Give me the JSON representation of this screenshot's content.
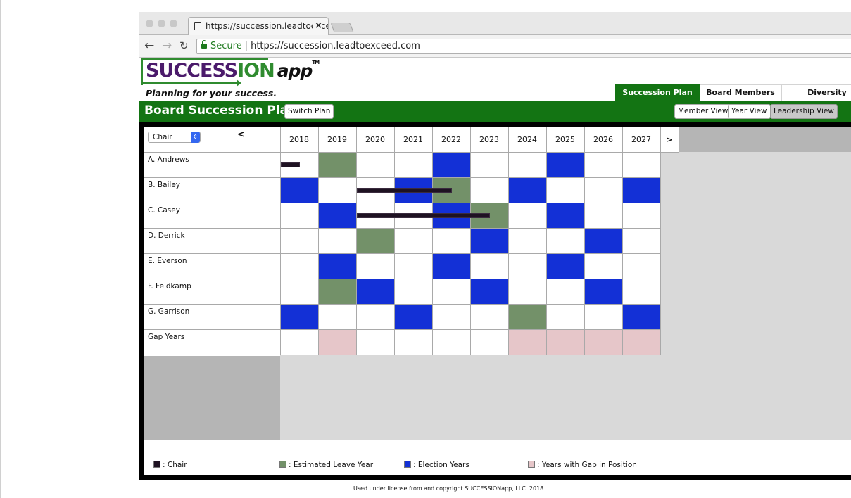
{
  "browser": {
    "tab_title": "https://succession.leadtoexceed.com",
    "close_glyph": "×",
    "secure_label": "Secure",
    "url": "https://succession.leadtoexceed.com"
  },
  "logo": {
    "part1": "SUCCESS",
    "part2": "ION",
    "part3": "app",
    "tm": "TM",
    "tagline": "Planning for your success."
  },
  "nav_tabs": [
    {
      "label": "Succession Plan",
      "active": true
    },
    {
      "label": "Board Members",
      "active": false
    },
    {
      "label": "Diversity",
      "active": false
    }
  ],
  "header": {
    "title": "Board Succession Plan",
    "switch_plan": "Switch Plan",
    "views": [
      {
        "label": "Member View",
        "selected": false
      },
      {
        "label": "Year View",
        "selected": false
      },
      {
        "label": "Leadership View",
        "selected": true
      }
    ]
  },
  "grid": {
    "position_select": "Chair",
    "prev_label": "<",
    "next_label": ">",
    "years": [
      "2018",
      "2019",
      "2020",
      "2021",
      "2022",
      "2023",
      "2024",
      "2025",
      "2026",
      "2027"
    ],
    "colors": {
      "chair": "#1e1222",
      "leave": "#739169",
      "election": "#1330d6",
      "gap": "#e6c6c9",
      "empty": "#ffffff"
    },
    "rows": [
      {
        "name": "A. Andrews",
        "cells": [
          "",
          "leave",
          "",
          "",
          "election",
          "",
          "",
          "election",
          "",
          ""
        ],
        "chair": {
          "start": 0,
          "end": 0.5
        }
      },
      {
        "name": "B. Bailey",
        "cells": [
          "election",
          "",
          "",
          "election",
          "leave",
          "",
          "election",
          "",
          "",
          "election"
        ],
        "chair": {
          "start": 2,
          "end": 4.5
        }
      },
      {
        "name": "C. Casey",
        "cells": [
          "",
          "election",
          "",
          "",
          "election",
          "leave",
          "",
          "election",
          "",
          ""
        ],
        "chair": {
          "start": 2,
          "end": 5.5
        }
      },
      {
        "name": "D. Derrick",
        "cells": [
          "",
          "",
          "leave",
          "",
          "",
          "election",
          "",
          "",
          "election",
          ""
        ]
      },
      {
        "name": "E. Everson",
        "cells": [
          "",
          "election",
          "",
          "",
          "election",
          "",
          "",
          "election",
          "",
          ""
        ]
      },
      {
        "name": "F. Feldkamp",
        "cells": [
          "",
          "leave",
          "election",
          "",
          "",
          "election",
          "",
          "",
          "election",
          ""
        ]
      },
      {
        "name": "G. Garrison",
        "cells": [
          "election",
          "",
          "",
          "election",
          "",
          "",
          "leave",
          "",
          "",
          "election"
        ]
      },
      {
        "name": "Gap Years",
        "cells": [
          "",
          "gap",
          "",
          "",
          "",
          "",
          "gap",
          "gap",
          "gap",
          "gap"
        ]
      }
    ]
  },
  "legend": [
    {
      "key": "chair",
      "label": ": Chair",
      "color": "#1e1222"
    },
    {
      "key": "leave",
      "label": ": Estimated Leave Year",
      "color": "#739169"
    },
    {
      "key": "election",
      "label": ": Election Years",
      "color": "#1330d6"
    },
    {
      "key": "gap",
      "label": ": Years with Gap in Position",
      "color": "#e6c6c9"
    }
  ],
  "footer": "Used under license from and copyright SUCCESSIONapp, LLC. 2018"
}
